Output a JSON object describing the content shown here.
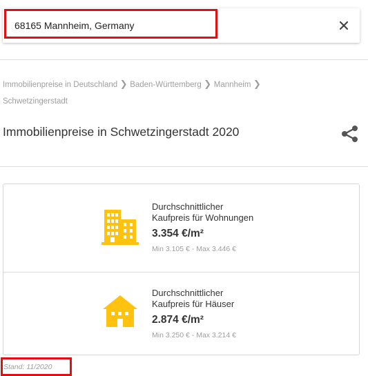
{
  "search": {
    "value": "68165 Mannheim, Germany",
    "clear_icon": "close-icon"
  },
  "breadcrumb": [
    {
      "label": "Immobilienpreise in Deutschland"
    },
    {
      "label": "Baden-Württemberg"
    },
    {
      "label": "Mannheim"
    },
    {
      "label": "Schwetzingerstadt"
    }
  ],
  "page": {
    "title": "Immobilienpreise in Schwetzingerstadt 2020",
    "share_icon": "share-icon"
  },
  "prices": [
    {
      "icon": "apartment-buildings-icon",
      "label_line1": "Durchschnittlicher",
      "label_line2": "Kaufpreis für Wohnungen",
      "value": "3.354 €/m²",
      "range": "Min 3.105 € - Max 3.446 €"
    },
    {
      "icon": "house-icon",
      "label_line1": "Durchschnittlicher",
      "label_line2": "Kaufpreis für Häuser",
      "value": "2.874 €/m²",
      "range": "Min 3.250 € - Max 3.214 €"
    }
  ],
  "footer": {
    "stand": "Stand: 11/2020"
  },
  "colors": {
    "icon_yellow": "#ffc20e",
    "highlight_red": "#e01010",
    "muted_text": "#9e9e9e"
  }
}
